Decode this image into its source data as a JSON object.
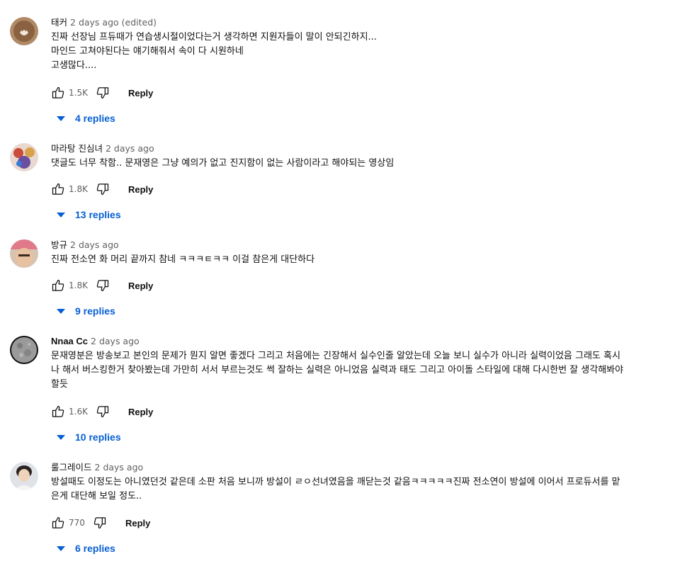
{
  "comments": [
    {
      "author": "태커",
      "date": "2 days ago (edited)",
      "lines": [
        "진짜 선장님 프듀때가 연습생시절이었다는거 생각하면 지원자들이 말이 안되긴하지...",
        "마인드 고쳐야된다는 얘기해줘서 속이 다 시원하네",
        "고생많다...."
      ],
      "likes": "1.5K",
      "reply_label": "Reply",
      "replies": "4 replies"
    },
    {
      "author": "마라탕 진심녀",
      "date": "2 days ago",
      "lines": [
        "댓글도 너무 착함.. 문재영은 그냥 예의가 없고 진지함이 없는 사람이라고 해야되는 영상임"
      ],
      "likes": "1.8K",
      "reply_label": "Reply",
      "replies": "13 replies"
    },
    {
      "author": "방규",
      "date": "2 days ago",
      "lines": [
        "진짜 전소연 화 머리 끝까지 참네 ㅋㅋㅋㅌㅋㅋ 이걸 참은게 대단하다"
      ],
      "likes": "1.8K",
      "reply_label": "Reply",
      "replies": "9 replies"
    },
    {
      "author": "Nnaa Cc",
      "date": "2 days ago",
      "lines": [
        "문재영분은 방송보고 본인의 문제가 뭔지 알면 좋겠다 그리고 처음에는 긴장해서 실수인줄 알았는데 오늘 보니 실수가 아니라 실력이었음 그래도 혹시",
        "나 해서 버스킹한거 찾아봤는데 가만히 서서 부르는것도 썩 잘하는 실력은 아니었음 실력과 태도 그리고 아이돌 스타일에 대해 다시한번 잘 생각해봐야",
        "할듯"
      ],
      "likes": "1.6K",
      "reply_label": "Reply",
      "replies": "10 replies"
    },
    {
      "author": "룰그레이드",
      "date": "2 days ago",
      "lines": [
        "방설때도 이정도는 아니였던것 같은데 소판 처음 보니까 방설이 ㄹㅇ선녀였음을 깨닫는것 같음ㅋㅋㅋㅋㅋ진짜 전소연이 방설에 이어서 프로듀서를 맡",
        "은게 대단해 보일 정도.."
      ],
      "likes": "770",
      "reply_label": "Reply",
      "replies": "6 replies"
    }
  ],
  "icons": {
    "like": "thumb-up-icon",
    "dislike": "thumb-down-icon",
    "expand": "triangle-down-icon"
  },
  "colors": {
    "link": "#065fd4",
    "meta": "#606060",
    "text": "#0f0f0f"
  }
}
